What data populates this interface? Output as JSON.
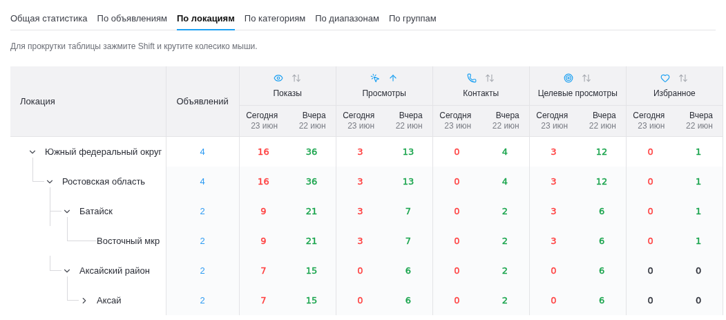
{
  "tabs": [
    {
      "label": "Общая статистика",
      "selected": false
    },
    {
      "label": "По объявлениям",
      "selected": false
    },
    {
      "label": "По локациям",
      "selected": true
    },
    {
      "label": "По категориям",
      "selected": false
    },
    {
      "label": "По диапазонам",
      "selected": false
    },
    {
      "label": "По группам",
      "selected": false
    }
  ],
  "hint": "Для прокрутки таблицы зажмите Shift и крутите колесико мыши.",
  "table": {
    "location_header": "Локация",
    "count_header": "Объявлений",
    "metrics": [
      {
        "label": "Показы",
        "sorted": false,
        "today": "Сегодня",
        "today_date": "23 июн",
        "yesterday": "Вчера",
        "yesterday_date": "22 июн"
      },
      {
        "label": "Просмотры",
        "sorted": true,
        "today": "Сегодня",
        "today_date": "23 июн",
        "yesterday": "Вчера",
        "yesterday_date": "22 июн"
      },
      {
        "label": "Контакты",
        "sorted": false,
        "today": "Сегодня",
        "today_date": "23 июн",
        "yesterday": "Вчера",
        "yesterday_date": "22 июн"
      },
      {
        "label": "Целевые просмотры",
        "sorted": false,
        "today": "Сегодня",
        "today_date": "23 июн",
        "yesterday": "Вчера",
        "yesterday_date": "22 июн"
      },
      {
        "label": "Избранное",
        "sorted": false,
        "today": "Сегодня",
        "today_date": "23 июн",
        "yesterday": "Вчера",
        "yesterday_date": "22 июн"
      }
    ],
    "rows": [
      {
        "location": "Южный федеральный округ",
        "expanded": true,
        "count": "4",
        "values": [
          {
            "text": "16",
            "color": "#ff3b3b"
          },
          {
            "text": "36",
            "color": "#16a34a"
          },
          {
            "text": "3",
            "color": "#ff3b3b"
          },
          {
            "text": "13",
            "color": "#16a34a"
          },
          {
            "text": "0",
            "color": "#ff3b3b"
          },
          {
            "text": "4",
            "color": "#16a34a"
          },
          {
            "text": "3",
            "color": "#ff3b3b"
          },
          {
            "text": "12",
            "color": "#16a34a"
          },
          {
            "text": "0",
            "color": "#ff3b3b"
          },
          {
            "text": "1",
            "color": "#16a34a"
          }
        ],
        "children": [
          {
            "location": "Ростовская область",
            "expanded": true,
            "count": "4",
            "values": [
              {
                "text": "16",
                "color": "#ff3b3b"
              },
              {
                "text": "36",
                "color": "#16a34a"
              },
              {
                "text": "3",
                "color": "#ff3b3b"
              },
              {
                "text": "13",
                "color": "#16a34a"
              },
              {
                "text": "0",
                "color": "#ff3b3b"
              },
              {
                "text": "4",
                "color": "#16a34a"
              },
              {
                "text": "3",
                "color": "#ff3b3b"
              },
              {
                "text": "12",
                "color": "#16a34a"
              },
              {
                "text": "0",
                "color": "#ff3b3b"
              },
              {
                "text": "1",
                "color": "#16a34a"
              }
            ],
            "children": [
              {
                "location": "Батайск",
                "expanded": true,
                "count": "2",
                "values": [
                  {
                    "text": "9",
                    "color": "#ff3b3b"
                  },
                  {
                    "text": "21",
                    "color": "#16a34a"
                  },
                  {
                    "text": "3",
                    "color": "#ff3b3b"
                  },
                  {
                    "text": "7",
                    "color": "#16a34a"
                  },
                  {
                    "text": "0",
                    "color": "#ff3b3b"
                  },
                  {
                    "text": "2",
                    "color": "#16a34a"
                  },
                  {
                    "text": "3",
                    "color": "#ff3b3b"
                  },
                  {
                    "text": "6",
                    "color": "#16a34a"
                  },
                  {
                    "text": "0",
                    "color": "#ff3b3b"
                  },
                  {
                    "text": "1",
                    "color": "#16a34a"
                  }
                ],
                "children": [
                  {
                    "location": "Восточный мкр",
                    "count": "2",
                    "values": [
                      {
                        "text": "9",
                        "color": "#ff3b3b"
                      },
                      {
                        "text": "21",
                        "color": "#16a34a"
                      },
                      {
                        "text": "3",
                        "color": "#ff3b3b"
                      },
                      {
                        "text": "7",
                        "color": "#16a34a"
                      },
                      {
                        "text": "0",
                        "color": "#ff3b3b"
                      },
                      {
                        "text": "2",
                        "color": "#16a34a"
                      },
                      {
                        "text": "3",
                        "color": "#ff3b3b"
                      },
                      {
                        "text": "6",
                        "color": "#16a34a"
                      },
                      {
                        "text": "0",
                        "color": "#ff3b3b"
                      },
                      {
                        "text": "1",
                        "color": "#16a34a"
                      }
                    ]
                  }
                ]
              },
              {
                "location": "Аксайский район",
                "expanded": true,
                "count": "2",
                "values": [
                  {
                    "text": "7",
                    "color": "#ff3b3b"
                  },
                  {
                    "text": "15",
                    "color": "#16a34a"
                  },
                  {
                    "text": "0",
                    "color": "#ff3b3b"
                  },
                  {
                    "text": "6",
                    "color": "#16a34a"
                  },
                  {
                    "text": "0",
                    "color": "#ff3b3b"
                  },
                  {
                    "text": "2",
                    "color": "#16a34a"
                  },
                  {
                    "text": "0",
                    "color": "#ff3b3b"
                  },
                  {
                    "text": "6",
                    "color": "#16a34a"
                  },
                  {
                    "text": "0",
                    "color": "#2a2d36"
                  },
                  {
                    "text": "0",
                    "color": "#2a2d36"
                  }
                ],
                "children": [
                  {
                    "location": "Аксай",
                    "expanded": false,
                    "count": "2",
                    "values": [
                      {
                        "text": "7",
                        "color": "#ff3b3b"
                      },
                      {
                        "text": "15",
                        "color": "#16a34a"
                      },
                      {
                        "text": "0",
                        "color": "#ff3b3b"
                      },
                      {
                        "text": "6",
                        "color": "#16a34a"
                      },
                      {
                        "text": "0",
                        "color": "#ff3b3b"
                      },
                      {
                        "text": "2",
                        "color": "#16a34a"
                      },
                      {
                        "text": "0",
                        "color": "#ff3b3b"
                      },
                      {
                        "text": "6",
                        "color": "#16a34a"
                      },
                      {
                        "text": "0",
                        "color": "#2a2d36"
                      },
                      {
                        "text": "0",
                        "color": "#2a2d36"
                      }
                    ]
                  }
                ]
              }
            ]
          }
        ]
      }
    ]
  }
}
